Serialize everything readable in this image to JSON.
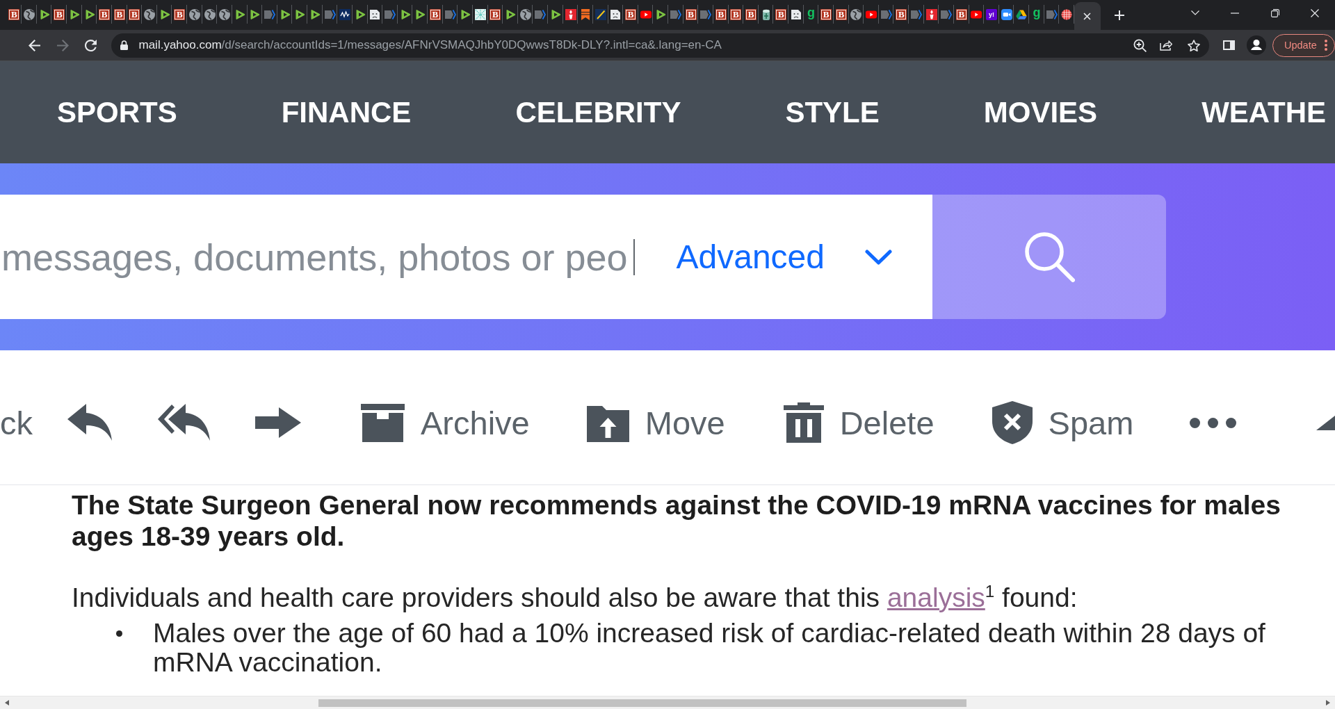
{
  "browser": {
    "tabs": [
      {
        "kind": "b-tile",
        "glyph": "B",
        "selected": false
      },
      {
        "kind": "globe",
        "selected": false
      },
      {
        "kind": "play",
        "selected": false
      },
      {
        "kind": "b-tile",
        "glyph": "B",
        "selected": false
      },
      {
        "kind": "play",
        "selected": false
      },
      {
        "kind": "play",
        "selected": false
      },
      {
        "kind": "b-tile",
        "glyph": "B",
        "selected": false
      },
      {
        "kind": "b-tile",
        "glyph": "B",
        "selected": false
      },
      {
        "kind": "b-tile",
        "glyph": "B",
        "selected": false
      },
      {
        "kind": "globe",
        "selected": false
      },
      {
        "kind": "play",
        "selected": false
      },
      {
        "kind": "b-tile",
        "glyph": "B",
        "selected": false
      },
      {
        "kind": "globe",
        "selected": false
      },
      {
        "kind": "globe",
        "selected": false
      },
      {
        "kind": "globe",
        "selected": false
      },
      {
        "kind": "play",
        "selected": false
      },
      {
        "kind": "play",
        "selected": false
      },
      {
        "kind": "chevron",
        "selected": false
      },
      {
        "kind": "play",
        "selected": false
      },
      {
        "kind": "play",
        "selected": false
      },
      {
        "kind": "play",
        "selected": false
      },
      {
        "kind": "chevron",
        "selected": false
      },
      {
        "kind": "wave",
        "selected": false
      },
      {
        "kind": "play",
        "selected": false
      },
      {
        "kind": "sad",
        "selected": false
      },
      {
        "kind": "chevron",
        "selected": false
      },
      {
        "kind": "play",
        "selected": false
      },
      {
        "kind": "play",
        "selected": false
      },
      {
        "kind": "b-tile",
        "glyph": "B",
        "selected": false
      },
      {
        "kind": "chevron",
        "selected": false
      },
      {
        "kind": "play",
        "selected": false
      },
      {
        "kind": "pattern",
        "selected": false
      },
      {
        "kind": "b-tile",
        "glyph": "B",
        "selected": false
      },
      {
        "kind": "play",
        "selected": false
      },
      {
        "kind": "globe",
        "selected": false
      },
      {
        "kind": "chevron",
        "selected": false
      },
      {
        "kind": "play",
        "selected": false
      },
      {
        "kind": "torch",
        "selected": false
      },
      {
        "kind": "bookmark",
        "selected": false
      },
      {
        "kind": "slash",
        "selected": false
      },
      {
        "kind": "sad",
        "selected": false
      },
      {
        "kind": "b-tile",
        "glyph": "B",
        "selected": false
      },
      {
        "kind": "video",
        "selected": false
      },
      {
        "kind": "play",
        "selected": false
      },
      {
        "kind": "chevron",
        "selected": false
      },
      {
        "kind": "b-tile",
        "glyph": "B",
        "selected": false
      },
      {
        "kind": "chevron",
        "selected": false
      },
      {
        "kind": "b-tile",
        "glyph": "B",
        "selected": false
      },
      {
        "kind": "b-tile",
        "glyph": "B",
        "selected": false
      },
      {
        "kind": "b-tile",
        "glyph": "B",
        "selected": false
      },
      {
        "kind": "jar",
        "selected": false
      },
      {
        "kind": "b-tile",
        "glyph": "B",
        "selected": false
      },
      {
        "kind": "sad",
        "selected": false
      },
      {
        "kind": "g-letter",
        "glyph": "g",
        "selected": false
      },
      {
        "kind": "b-tile",
        "glyph": "B",
        "selected": false
      },
      {
        "kind": "b-tile",
        "glyph": "B",
        "selected": false
      },
      {
        "kind": "globe",
        "selected": false
      },
      {
        "kind": "video",
        "selected": false
      },
      {
        "kind": "chevron",
        "selected": false
      },
      {
        "kind": "b-tile",
        "glyph": "B",
        "selected": false
      },
      {
        "kind": "chevron",
        "selected": false
      },
      {
        "kind": "torch",
        "selected": false
      },
      {
        "kind": "chevron",
        "selected": false
      },
      {
        "kind": "b-tile",
        "glyph": "B",
        "selected": false
      },
      {
        "kind": "video",
        "selected": false
      },
      {
        "kind": "y-tile",
        "glyph": "y!",
        "selected": false
      },
      {
        "kind": "camera",
        "selected": false
      },
      {
        "kind": "drive",
        "selected": false
      },
      {
        "kind": "g-letter",
        "glyph": "g",
        "selected": false
      },
      {
        "kind": "chevron",
        "selected": false
      },
      {
        "kind": "cylinder",
        "selected": false
      },
      {
        "kind": "none",
        "selected": true
      }
    ],
    "nav_buttons": [
      {
        "kind": "back",
        "disabled": false
      },
      {
        "kind": "forward",
        "disabled": true
      },
      {
        "kind": "reload",
        "disabled": false
      }
    ],
    "address": {
      "host": "mail.yahoo.com",
      "path": "/d/search/accountIds=1/messages/AFNrVSMAQJhbY0DQwwsT8Dk-DLY?.intl=ca&.lang=en-CA"
    },
    "update_button": "Update"
  },
  "site_nav": {
    "items": [
      "SPORTS",
      "FINANCE",
      "CELEBRITY",
      "STYLE",
      "MOVIES",
      "WEATHE"
    ]
  },
  "search": {
    "placeholder": "messages, documents, photos or peo",
    "advanced": "Advanced"
  },
  "mail_toolbar": {
    "items": [
      {
        "kind": "back",
        "label": "ck"
      },
      {
        "kind": "reply"
      },
      {
        "kind": "reply-all"
      },
      {
        "kind": "forward"
      },
      {
        "kind": "archive",
        "label": "Archive"
      },
      {
        "kind": "move",
        "label": "Move"
      },
      {
        "kind": "delete",
        "label": "Delete"
      },
      {
        "kind": "spam",
        "label": "Spam"
      },
      {
        "kind": "more"
      },
      {
        "kind": "collapse"
      }
    ]
  },
  "message": {
    "heading": "The State Surgeon General now recommends against the COVID-19 mRNA vaccines for males ages 18-39 years old.",
    "paragraph": {
      "text_before": "Individuals and health care providers should also be aware that this ",
      "link": "analysis",
      "text_after": "$^{1}$ found:"
    },
    "bullets": [
      "Males over the age of 60 had a 10% increased risk of cardiac-related death within 28 days of mRNA vaccination."
    ]
  }
}
